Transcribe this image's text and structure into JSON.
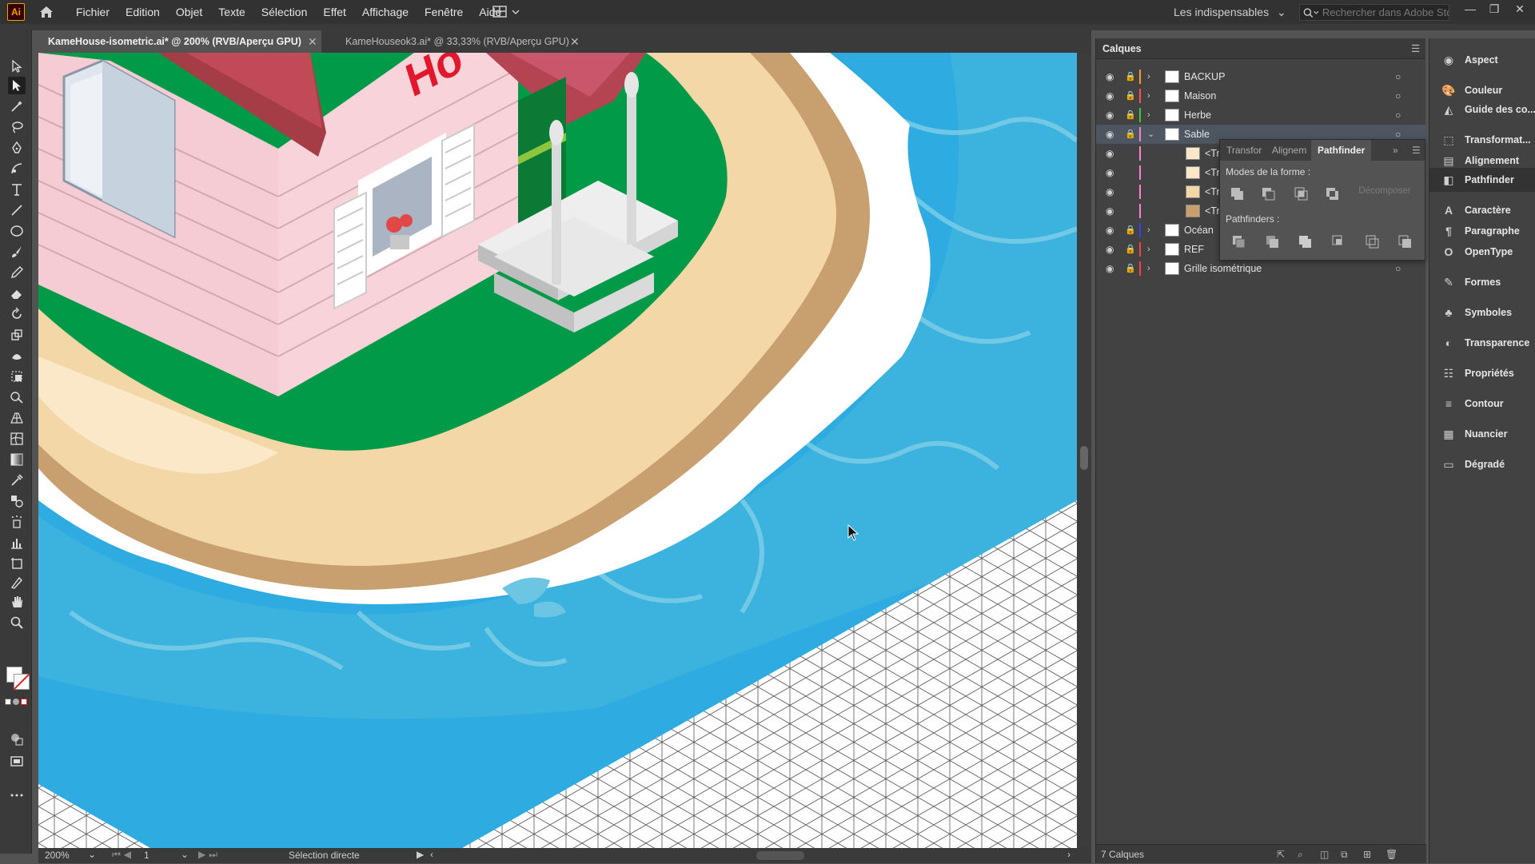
{
  "app": {
    "logo": "Ai"
  },
  "menu": [
    "Fichier",
    "Edition",
    "Objet",
    "Texte",
    "Sélection",
    "Effet",
    "Affichage",
    "Fenêtre",
    "Aide"
  ],
  "workspace": {
    "label": "Les indispensables"
  },
  "search": {
    "placeholder": "Rechercher dans Adobe Stock"
  },
  "tabs": [
    {
      "label": "KameHouse-isometric.ai* @ 200% (RVB/Aperçu GPU)",
      "active": true
    },
    {
      "label": "KameHouseok3.ai* @ 33,33% (RVB/Aperçu GPU)",
      "active": false
    }
  ],
  "status": {
    "zoom": "200%",
    "artboard": "1",
    "tool": "Sélection directe"
  },
  "layers": {
    "title": "Calques",
    "count_label": "7 Calques",
    "rows": [
      {
        "name": "BACKUP",
        "color": "#ff9a2e",
        "expanded": false
      },
      {
        "name": "Maison",
        "color": "#ff4f4f",
        "expanded": false
      },
      {
        "name": "Herbe",
        "color": "#3ec83e",
        "expanded": false
      },
      {
        "name": "Sable",
        "color": "#ff7fd0",
        "expanded": true
      },
      {
        "name": "<Tr",
        "sub": true
      },
      {
        "name": "<Tr",
        "sub": true
      },
      {
        "name": "<Tr",
        "sub": true
      },
      {
        "name": "<Tr",
        "sub": true
      },
      {
        "name": "Océan",
        "color": "#3b3bff",
        "expanded": false
      },
      {
        "name": "REF",
        "color": "#ff4040",
        "expanded": false
      },
      {
        "name": "Grille isométrique",
        "color": "#ff4040",
        "expanded": false
      }
    ]
  },
  "pathfinder": {
    "tabs": [
      "Transfor",
      "Alignem",
      "Pathfinder"
    ],
    "shape_modes_label": "Modes de la forme :",
    "expand_label": "Décomposer",
    "pathfinders_label": "Pathfinders :"
  },
  "dock": [
    {
      "label": "Aspect",
      "icon": "appearance-icon"
    },
    {
      "label": "Couleur",
      "icon": "color-icon"
    },
    {
      "label": "Guide des co...",
      "icon": "color-guide-icon"
    },
    {
      "label": "Transformat...",
      "icon": "transform-icon"
    },
    {
      "label": "Alignement",
      "icon": "align-icon"
    },
    {
      "label": "Pathfinder",
      "icon": "pathfinder-icon",
      "active": true
    },
    {
      "label": "Caractère",
      "icon": "character-icon"
    },
    {
      "label": "Paragraphe",
      "icon": "paragraph-icon"
    },
    {
      "label": "OpenType",
      "icon": "opentype-icon"
    },
    {
      "label": "Formes",
      "icon": "brushes-icon"
    },
    {
      "label": "Symboles",
      "icon": "symbols-icon"
    },
    {
      "label": "Transparence",
      "icon": "transparency-icon"
    },
    {
      "label": "Propriétés",
      "icon": "properties-icon"
    },
    {
      "label": "Contour",
      "icon": "stroke-icon"
    },
    {
      "label": "Nuancier",
      "icon": "swatches-icon"
    },
    {
      "label": "Dégradé",
      "icon": "gradient-icon"
    }
  ],
  "artwork": {
    "sign_text": "Ho"
  }
}
